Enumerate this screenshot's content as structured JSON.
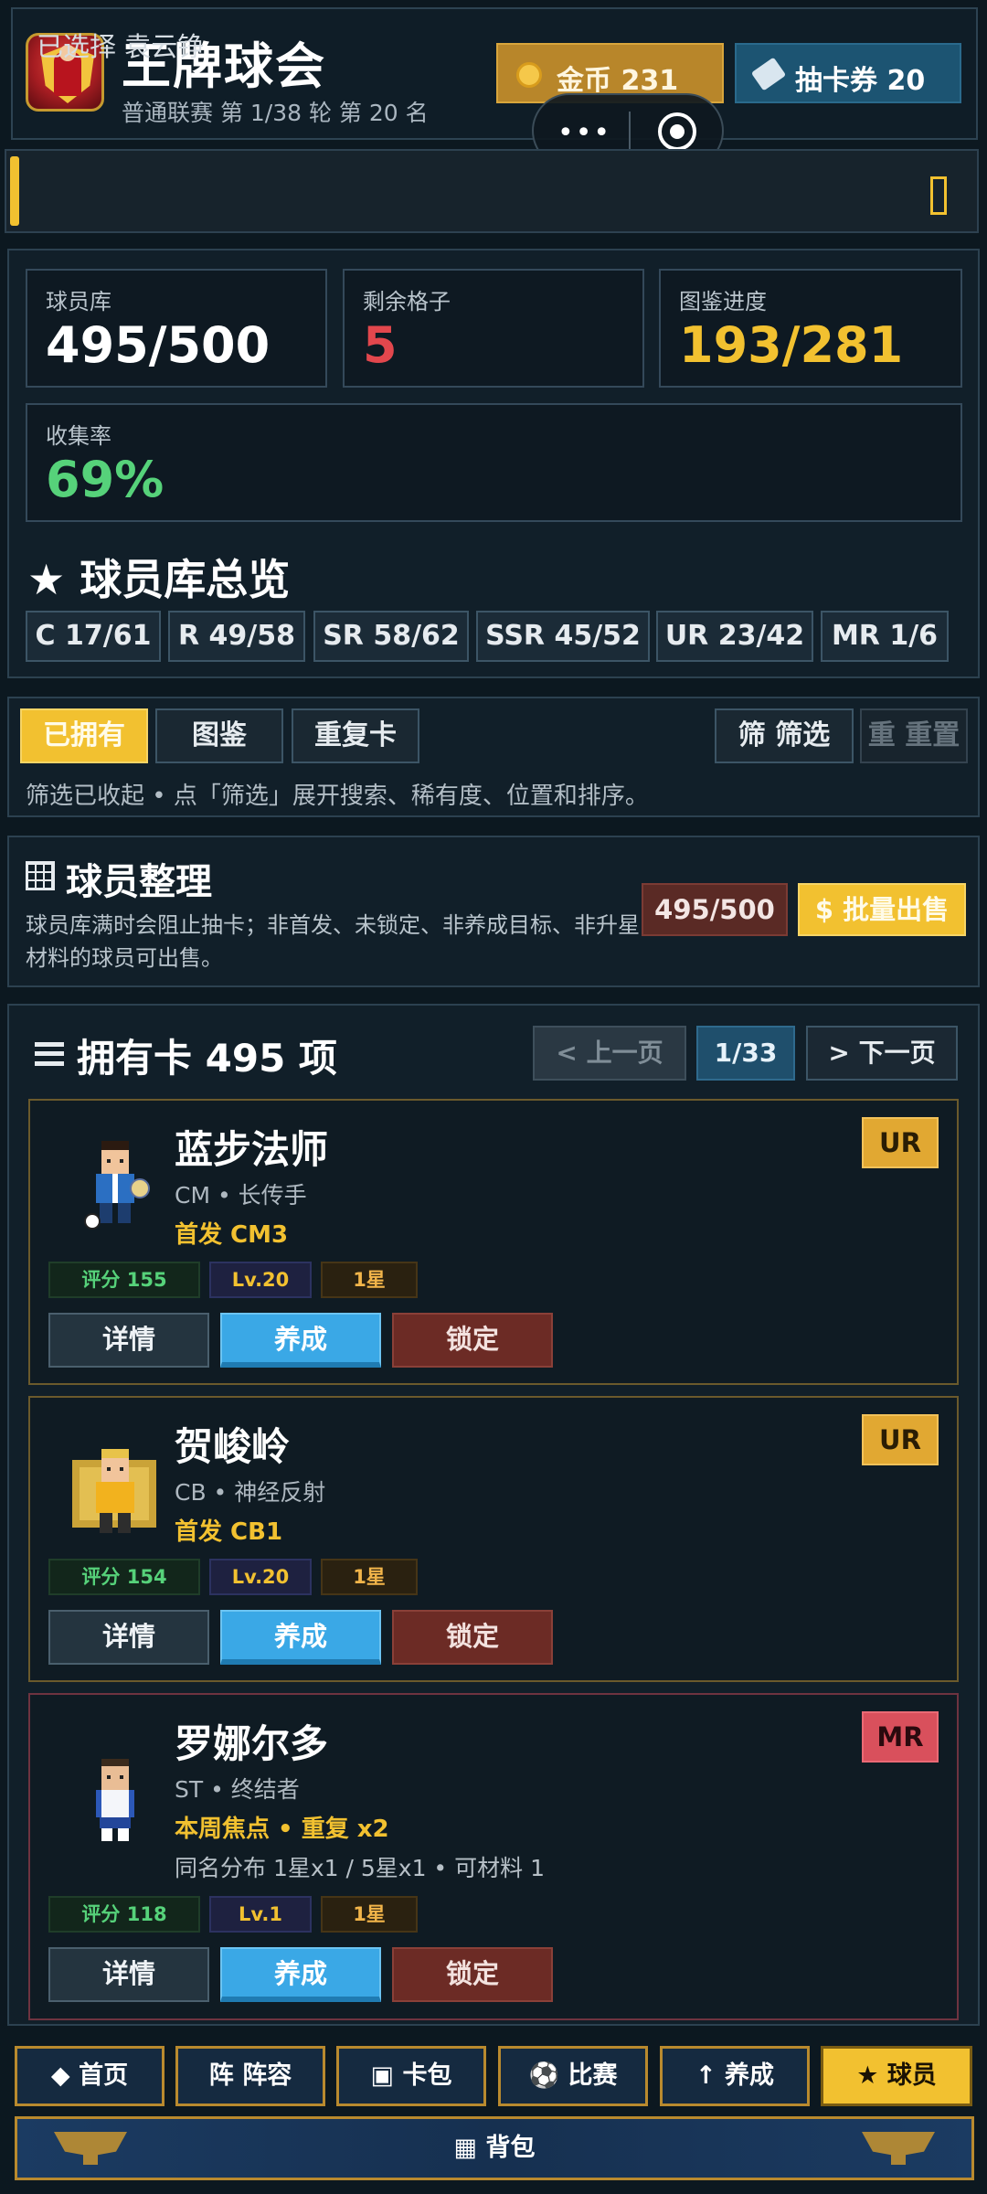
{
  "header": {
    "title": "王牌球会",
    "league": "普通联赛 第 1/38 轮 第 20 名",
    "coins_label": "金币 231",
    "tickets_label": "抽卡券 20",
    "capsule_more": "•••"
  },
  "selection": {
    "text": "已选择 袁云铮"
  },
  "stats": {
    "library_label": "球员库",
    "library_value": "495/500",
    "slots_label": "剩余格子",
    "slots_value": "5",
    "dex_label": "图鉴进度",
    "dex_value": "193/281",
    "rate_label": "收集率",
    "rate_value": "69%"
  },
  "overview": {
    "title": "★ 球员库总览",
    "rarities": [
      "C 17/61",
      "R 49/58",
      "SR 58/62",
      "SSR 45/52",
      "UR 23/42",
      "MR 1/6"
    ]
  },
  "tabs": {
    "owned": "已拥有",
    "dex": "图鉴",
    "duplicates": "重复卡",
    "filter": "筛 筛选",
    "reset": "重 重置",
    "hint": "筛选已收起 • 点「筛选」展开搜索、稀有度、位置和排序。"
  },
  "organize": {
    "title": "球员整理",
    "desc": "球员库满时会阻止抽卡；非首发、未锁定、非养成目标、非升星材料的球员可出售。",
    "count": "495/500",
    "bulk_sell": "$ 批量出售"
  },
  "list": {
    "title": "拥有卡 495 项",
    "prev": "< 上一页",
    "page": "1/33",
    "next": "> 下一页"
  },
  "cards": [
    {
      "name": "蓝步法师",
      "trait": "CM • 长传手",
      "starter": "首发 CM3",
      "extra": "",
      "rarity": "UR",
      "score": "评分 155",
      "level": "Lv.20",
      "stars": "1星",
      "btn_detail": "详情",
      "btn_train": "养成",
      "btn_lock": "锁定"
    },
    {
      "name": "贺峻岭",
      "trait": "CB • 神经反射",
      "starter": "首发 CB1",
      "extra": "",
      "rarity": "UR",
      "score": "评分 154",
      "level": "Lv.20",
      "stars": "1星",
      "btn_detail": "详情",
      "btn_train": "养成",
      "btn_lock": "锁定"
    },
    {
      "name": "罗娜尔多",
      "trait": "ST • 终结者",
      "starter": "本周焦点 • 重复 x2",
      "extra": "同名分布 1星x1 / 5星x1 • 可材料 1",
      "rarity": "MR",
      "score": "评分 118",
      "level": "Lv.1",
      "stars": "1星",
      "btn_detail": "详情",
      "btn_train": "养成",
      "btn_lock": "锁定"
    }
  ],
  "nav": {
    "home": "◆ 首页",
    "lineup": "阵 阵容",
    "packs": "▣ 卡包",
    "match": "⚽ 比赛",
    "training": "↑ 养成",
    "players": "★ 球员",
    "backpack": "▦ 背包"
  },
  "colors": {
    "accent_gold": "#f2c130",
    "train_blue": "#3aa8e6",
    "lock_red": "#6c2b25",
    "ur": "#e1a832",
    "mr": "#d9505c",
    "green": "#56d27a",
    "red_value": "#e2474d"
  },
  "icons": [
    "coin-icon",
    "ticket-icon",
    "grid-icon",
    "menu-icon"
  ]
}
